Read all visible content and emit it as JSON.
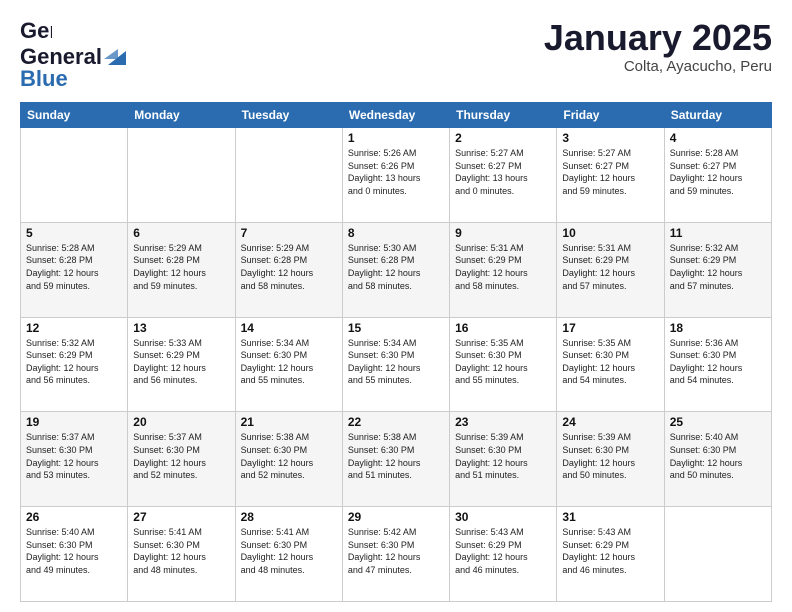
{
  "header": {
    "logo_general": "General",
    "logo_blue": "Blue",
    "month": "January 2025",
    "location": "Colta, Ayacucho, Peru"
  },
  "days_of_week": [
    "Sunday",
    "Monday",
    "Tuesday",
    "Wednesday",
    "Thursday",
    "Friday",
    "Saturday"
  ],
  "weeks": [
    [
      {
        "day": "",
        "info": ""
      },
      {
        "day": "",
        "info": ""
      },
      {
        "day": "",
        "info": ""
      },
      {
        "day": "1",
        "info": "Sunrise: 5:26 AM\nSunset: 6:26 PM\nDaylight: 13 hours\nand 0 minutes."
      },
      {
        "day": "2",
        "info": "Sunrise: 5:27 AM\nSunset: 6:27 PM\nDaylight: 13 hours\nand 0 minutes."
      },
      {
        "day": "3",
        "info": "Sunrise: 5:27 AM\nSunset: 6:27 PM\nDaylight: 12 hours\nand 59 minutes."
      },
      {
        "day": "4",
        "info": "Sunrise: 5:28 AM\nSunset: 6:27 PM\nDaylight: 12 hours\nand 59 minutes."
      }
    ],
    [
      {
        "day": "5",
        "info": "Sunrise: 5:28 AM\nSunset: 6:28 PM\nDaylight: 12 hours\nand 59 minutes."
      },
      {
        "day": "6",
        "info": "Sunrise: 5:29 AM\nSunset: 6:28 PM\nDaylight: 12 hours\nand 59 minutes."
      },
      {
        "day": "7",
        "info": "Sunrise: 5:29 AM\nSunset: 6:28 PM\nDaylight: 12 hours\nand 58 minutes."
      },
      {
        "day": "8",
        "info": "Sunrise: 5:30 AM\nSunset: 6:28 PM\nDaylight: 12 hours\nand 58 minutes."
      },
      {
        "day": "9",
        "info": "Sunrise: 5:31 AM\nSunset: 6:29 PM\nDaylight: 12 hours\nand 58 minutes."
      },
      {
        "day": "10",
        "info": "Sunrise: 5:31 AM\nSunset: 6:29 PM\nDaylight: 12 hours\nand 57 minutes."
      },
      {
        "day": "11",
        "info": "Sunrise: 5:32 AM\nSunset: 6:29 PM\nDaylight: 12 hours\nand 57 minutes."
      }
    ],
    [
      {
        "day": "12",
        "info": "Sunrise: 5:32 AM\nSunset: 6:29 PM\nDaylight: 12 hours\nand 56 minutes."
      },
      {
        "day": "13",
        "info": "Sunrise: 5:33 AM\nSunset: 6:29 PM\nDaylight: 12 hours\nand 56 minutes."
      },
      {
        "day": "14",
        "info": "Sunrise: 5:34 AM\nSunset: 6:30 PM\nDaylight: 12 hours\nand 55 minutes."
      },
      {
        "day": "15",
        "info": "Sunrise: 5:34 AM\nSunset: 6:30 PM\nDaylight: 12 hours\nand 55 minutes."
      },
      {
        "day": "16",
        "info": "Sunrise: 5:35 AM\nSunset: 6:30 PM\nDaylight: 12 hours\nand 55 minutes."
      },
      {
        "day": "17",
        "info": "Sunrise: 5:35 AM\nSunset: 6:30 PM\nDaylight: 12 hours\nand 54 minutes."
      },
      {
        "day": "18",
        "info": "Sunrise: 5:36 AM\nSunset: 6:30 PM\nDaylight: 12 hours\nand 54 minutes."
      }
    ],
    [
      {
        "day": "19",
        "info": "Sunrise: 5:37 AM\nSunset: 6:30 PM\nDaylight: 12 hours\nand 53 minutes."
      },
      {
        "day": "20",
        "info": "Sunrise: 5:37 AM\nSunset: 6:30 PM\nDaylight: 12 hours\nand 52 minutes."
      },
      {
        "day": "21",
        "info": "Sunrise: 5:38 AM\nSunset: 6:30 PM\nDaylight: 12 hours\nand 52 minutes."
      },
      {
        "day": "22",
        "info": "Sunrise: 5:38 AM\nSunset: 6:30 PM\nDaylight: 12 hours\nand 51 minutes."
      },
      {
        "day": "23",
        "info": "Sunrise: 5:39 AM\nSunset: 6:30 PM\nDaylight: 12 hours\nand 51 minutes."
      },
      {
        "day": "24",
        "info": "Sunrise: 5:39 AM\nSunset: 6:30 PM\nDaylight: 12 hours\nand 50 minutes."
      },
      {
        "day": "25",
        "info": "Sunrise: 5:40 AM\nSunset: 6:30 PM\nDaylight: 12 hours\nand 50 minutes."
      }
    ],
    [
      {
        "day": "26",
        "info": "Sunrise: 5:40 AM\nSunset: 6:30 PM\nDaylight: 12 hours\nand 49 minutes."
      },
      {
        "day": "27",
        "info": "Sunrise: 5:41 AM\nSunset: 6:30 PM\nDaylight: 12 hours\nand 48 minutes."
      },
      {
        "day": "28",
        "info": "Sunrise: 5:41 AM\nSunset: 6:30 PM\nDaylight: 12 hours\nand 48 minutes."
      },
      {
        "day": "29",
        "info": "Sunrise: 5:42 AM\nSunset: 6:30 PM\nDaylight: 12 hours\nand 47 minutes."
      },
      {
        "day": "30",
        "info": "Sunrise: 5:43 AM\nSunset: 6:29 PM\nDaylight: 12 hours\nand 46 minutes."
      },
      {
        "day": "31",
        "info": "Sunrise: 5:43 AM\nSunset: 6:29 PM\nDaylight: 12 hours\nand 46 minutes."
      },
      {
        "day": "",
        "info": ""
      }
    ]
  ]
}
